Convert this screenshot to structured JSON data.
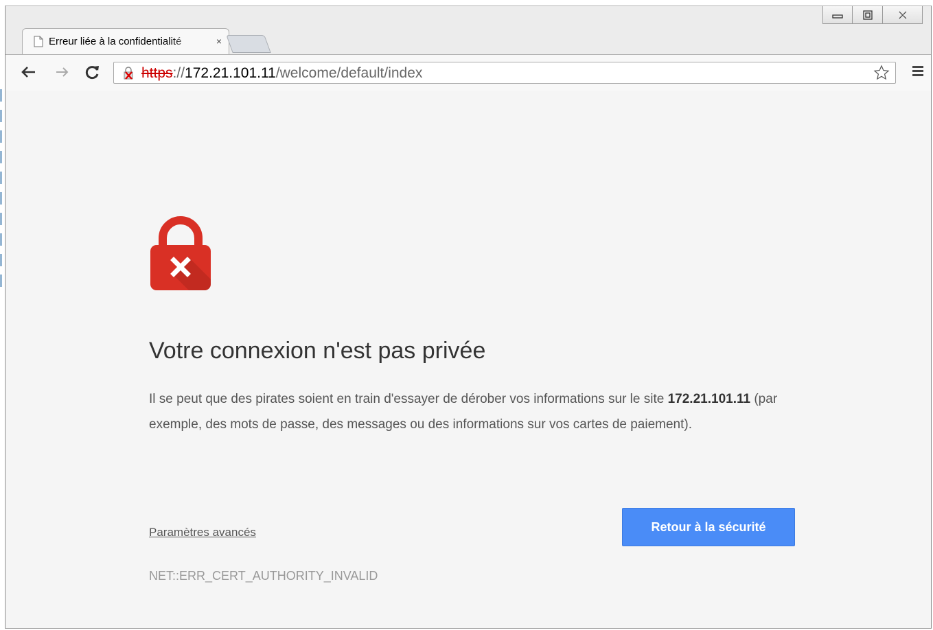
{
  "tab": {
    "title": "Erreur liée à la confidentialité",
    "close_glyph": "×",
    "icon": "page-icon"
  },
  "window_controls": [
    "minimize-icon",
    "maximize-icon",
    "close-icon"
  ],
  "toolbar": {
    "back_icon": "back-arrow-icon",
    "forward_icon": "forward-arrow-icon",
    "reload_icon": "reload-icon",
    "url_scheme": "https",
    "url_separator": "://",
    "url_host": "172.21.101.11",
    "url_path": "/welcome/default/index",
    "bookmark_icon": "star-icon",
    "menu_icon": "hamburger-menu-icon"
  },
  "interstitial": {
    "icon": "lock-error-icon",
    "heading": "Votre connexion n'est pas privée",
    "desc_before": "Il se peut que des pirates soient en train d'essayer de dérober vos informations sur le site",
    "desc_host": "172.21.101.11",
    "desc_after": "(par exemple, des mots de passe, des messages ou des informations sur vos cartes de paiement).",
    "advanced_link": "Paramètres avancés",
    "back_button": "Retour à la sécurité",
    "error_code": "NET::ERR_CERT_AUTHORITY_INVALID"
  },
  "colors": {
    "lock_red": "#d93025",
    "button_blue": "#4a8cf7",
    "page_bg": "#f5f5f5"
  }
}
